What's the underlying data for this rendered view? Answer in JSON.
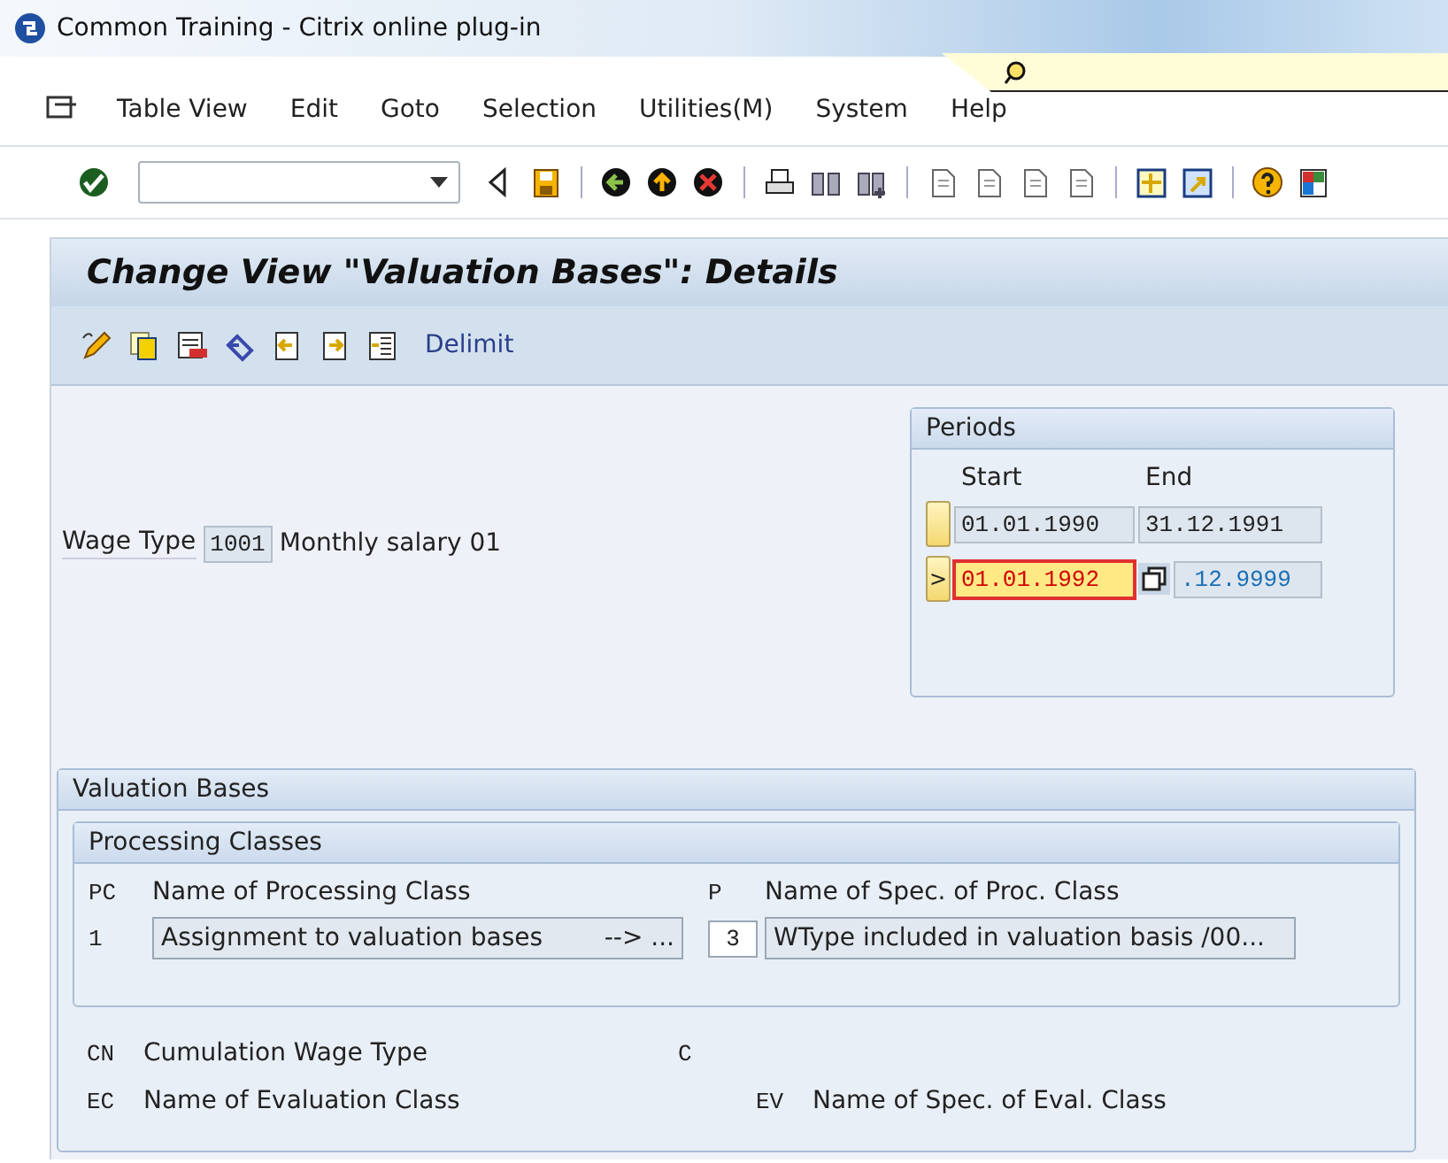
{
  "window": {
    "title": "Common Training - Citrix online plug-in"
  },
  "menu": [
    "Table View",
    "Edit",
    "Goto",
    "Selection",
    "Utilities(M)",
    "System",
    "Help"
  ],
  "screen_title": "Change View \"Valuation Bases\": Details",
  "app_toolbar": {
    "delimit": "Delimit"
  },
  "wage_type": {
    "label": "Wage Type",
    "value": "1001",
    "text": "Monthly salary 01"
  },
  "periods": {
    "title": "Periods",
    "columns": [
      "Start",
      "End"
    ],
    "rows": [
      {
        "start": "01.01.1990",
        "end": "31.12.1991",
        "selected": false
      },
      {
        "start": "01.01.1992",
        "end": ".12.9999",
        "selected": true,
        "marker": ">"
      }
    ]
  },
  "valuation_bases": {
    "title": "Valuation Bases",
    "processing_classes": {
      "title": "Processing Classes",
      "headers": [
        "PC",
        "Name of Processing Class",
        "P",
        "Name of Spec. of Proc. Class"
      ],
      "row": {
        "pc": "1",
        "name": "Assignment to valuation bases",
        "suffix": "--> ...",
        "p": "3",
        "spec": "WType included in valuation basis /00..."
      }
    },
    "cumulation": {
      "code": "CN",
      "label": "Cumulation Wage Type",
      "c": "C"
    },
    "evaluation": {
      "code": "EC",
      "label": "Name of Evaluation Class",
      "ev_code": "EV",
      "ev_label": "Name of Spec. of Eval. Class"
    }
  }
}
